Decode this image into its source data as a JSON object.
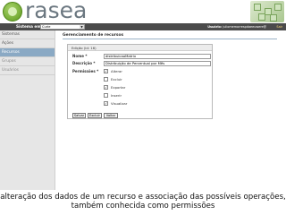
{
  "app": {
    "logo_text": "rasea"
  },
  "topbar": {
    "system_label": "Sistema em uso:",
    "system_value": "Curie",
    "user_prefix": "Usuário:",
    "user_name": "juliomemorrespdaeeuwere@",
    "logout": "Sair"
  },
  "sidebar": {
    "items": [
      {
        "label": "Sistemas"
      },
      {
        "label": "Ações"
      },
      {
        "label": "Recursos"
      },
      {
        "label": "Grupos"
      },
      {
        "label": "Usuários"
      }
    ],
    "active_index": 2
  },
  "main": {
    "title": "Gerenciamento de recursos",
    "panel_title": "Edição (id: 16)",
    "name_label": "Nome *",
    "name_value": "distribuicaoMatrix",
    "description_label": "Descrição *",
    "description_value": "Distribuição de Percentual por Mês",
    "permissions_label": "Permissões *",
    "permissions": [
      {
        "label": "Alterar",
        "checked": true
      },
      {
        "label": "Excluir",
        "checked": false
      },
      {
        "label": "Exportar",
        "checked": true
      },
      {
        "label": "Inserir",
        "checked": false
      },
      {
        "label": "Visualizar",
        "checked": true
      }
    ],
    "buttons": {
      "save": "Salvar",
      "delete": "Excluir",
      "back": "Voltar"
    }
  },
  "caption": "alteração dos dados de um recurso e associação das possíveis operações, também conhecida como permissões",
  "colors": {
    "topbar": "#4b4b4b",
    "sidebar_active": "#8aa9c4",
    "sidebar_bg": "#e6e6e6",
    "logo_green": "#5e9a1e"
  }
}
